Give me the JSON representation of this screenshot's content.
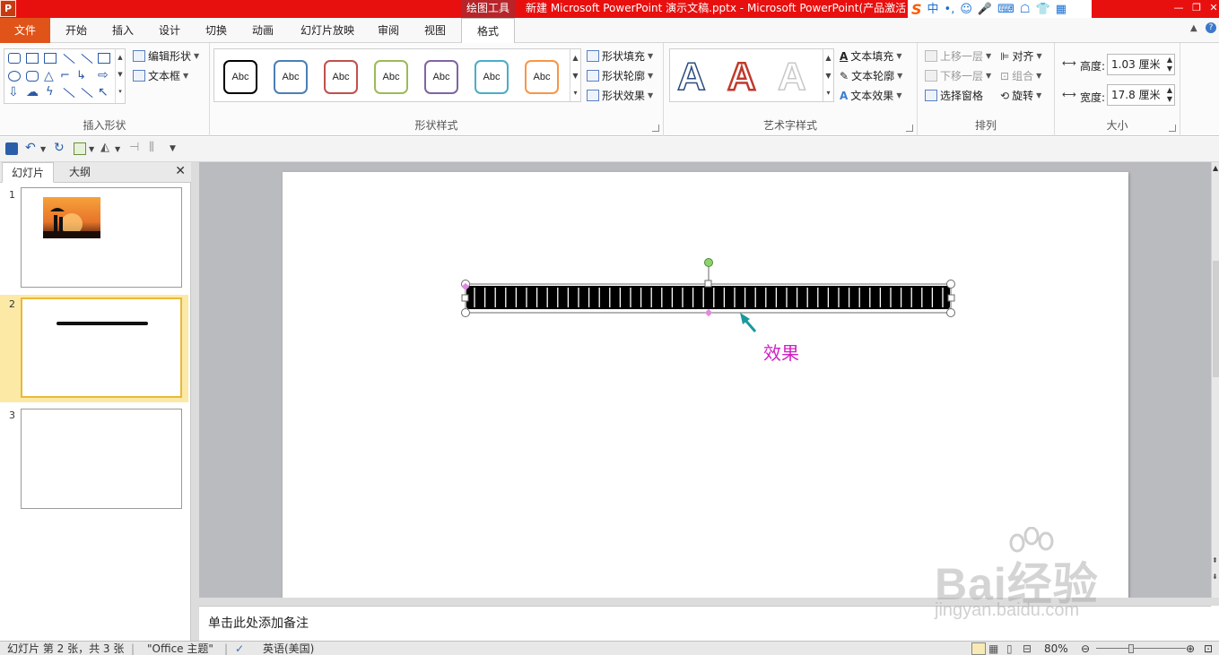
{
  "title_bar": {
    "app_icon": "P",
    "context_tab_label": "绘图工具",
    "window_title": "新建 Microsoft PowerPoint 演示文稿.pptx - Microsoft PowerPoint(产品激活",
    "ime": {
      "chinese": "中",
      "punct": "•,"
    }
  },
  "ribbon_tabs": [
    "文件",
    "开始",
    "插入",
    "设计",
    "切换",
    "动画",
    "幻灯片放映",
    "审阅",
    "视图",
    "格式"
  ],
  "ribbon": {
    "insert_shapes": {
      "edit_shape": "编辑形状",
      "text_box": "文本框",
      "label": "插入形状"
    },
    "shape_styles": {
      "swatches": [
        {
          "text": "Abc",
          "color": "#000000"
        },
        {
          "text": "Abc",
          "color": "#4a7fb5"
        },
        {
          "text": "Abc",
          "color": "#c0504d"
        },
        {
          "text": "Abc",
          "color": "#9bbb59"
        },
        {
          "text": "Abc",
          "color": "#8064a2"
        },
        {
          "text": "Abc",
          "color": "#4bacc6"
        },
        {
          "text": "Abc",
          "color": "#f79646"
        }
      ],
      "fill": "形状填充",
      "outline": "形状轮廓",
      "effects": "形状效果",
      "label": "形状样式"
    },
    "wordart_styles": {
      "letters": [
        {
          "text": "A",
          "style": "outline-blue"
        },
        {
          "text": "A",
          "style": "red-outline"
        },
        {
          "text": "A",
          "style": "light-outline"
        }
      ],
      "text_fill": "文本填充",
      "text_outline": "文本轮廓",
      "text_effects": "文本效果",
      "label": "艺术字样式"
    },
    "arrange": {
      "bring_forward": "上移一层",
      "send_backward": "下移一层",
      "selection_pane": "选择窗格",
      "align": "对齐",
      "group": "组合",
      "rotate": "旋转",
      "label": "排列"
    },
    "size": {
      "height_label": "高度:",
      "height_value": "1.03 厘米",
      "width_label": "宽度:",
      "width_value": "17.8 厘米",
      "label": "大小"
    }
  },
  "left_pane": {
    "tabs": [
      "幻灯片",
      "大纲"
    ],
    "slides": [
      {
        "number": "1"
      },
      {
        "number": "2",
        "selected": true
      },
      {
        "number": "3"
      }
    ]
  },
  "slide": {
    "annotation": "效果",
    "annotation_color": "#d021c4",
    "arrow_color": "#1a9a9a"
  },
  "notes": {
    "placeholder": "单击此处添加备注"
  },
  "status_bar": {
    "slide_info": "幻灯片 第 2 张，共 3 张",
    "theme": "\"Office 主题\"",
    "language": "英语(美国)",
    "zoom": "80%"
  },
  "watermark": {
    "main": "Bai经验",
    "sub": "jingyan.baidu.com"
  }
}
